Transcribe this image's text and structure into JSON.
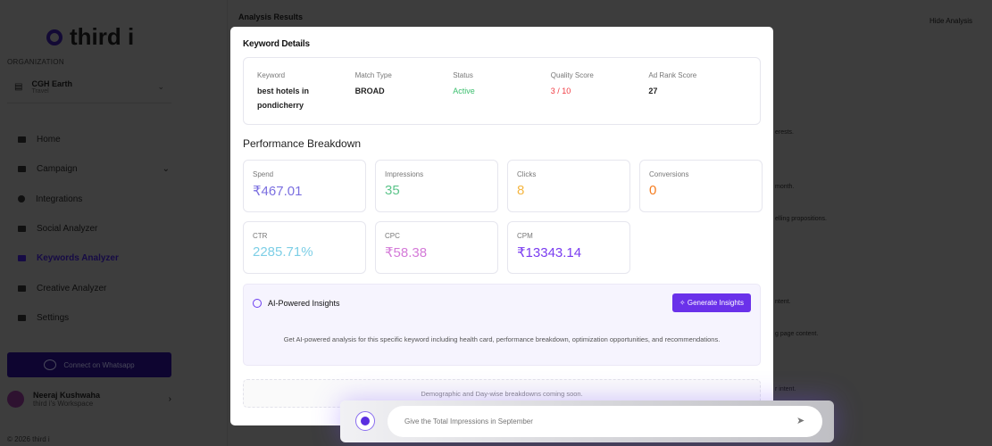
{
  "brand": "third i",
  "sidebar": {
    "org_label": "ORGANIZATION",
    "org_name": "CGH Earth",
    "org_type": "Travel",
    "items": [
      {
        "label": "Home"
      },
      {
        "label": "Campaign"
      },
      {
        "label": "Integrations"
      },
      {
        "label": "Social Analyzer"
      },
      {
        "label": "Keywords Analyzer"
      },
      {
        "label": "Creative Analyzer"
      },
      {
        "label": "Settings"
      }
    ],
    "whatsapp": "Connect on Whatsapp",
    "user_name": "Neeraj Kushwaha",
    "user_ws": "third i's Workspace",
    "copyright": "© 2026 third i"
  },
  "main": {
    "title": "Analysis Results",
    "hide": "Hide Analysis",
    "bg_lines": [
      "erests.",
      "month.",
      "elling propositions.",
      "ntent.",
      "g page content.",
      "r intent."
    ]
  },
  "modal": {
    "title": "Keyword Details",
    "details": [
      {
        "label": "Keyword",
        "value": "best hotels in pondicherry"
      },
      {
        "label": "Match Type",
        "value": "BROAD"
      },
      {
        "label": "Status",
        "value": "Active"
      },
      {
        "label": "Quality Score",
        "value": "3 / 10"
      },
      {
        "label": "Ad Rank Score",
        "value": "27"
      }
    ],
    "perf_title": "Performance Breakdown",
    "metrics": [
      {
        "label": "Spend",
        "value": "₹467.01",
        "color": "#7b6fe0"
      },
      {
        "label": "Impressions",
        "value": "35",
        "color": "#5cc48a"
      },
      {
        "label": "Clicks",
        "value": "8",
        "color": "#f5b642"
      },
      {
        "label": "Conversions",
        "value": "0",
        "color": "#f57c1f"
      },
      {
        "label": "CTR",
        "value": "2285.71%",
        "color": "#7ecfe6"
      },
      {
        "label": "CPC",
        "value": "₹58.38",
        "color": "#d47ad8"
      },
      {
        "label": "CPM",
        "value": "₹13343.14",
        "color": "#7a3cf0"
      }
    ],
    "ai_title": "AI-Powered Insights",
    "ai_button": "Generate Insights",
    "ai_desc": "Get AI-powered analysis for this specific keyword including health card, performance breakdown, optimization opportunities, and recommendations.",
    "soon": "Demographic and Day-wise breakdowns coming soon."
  },
  "chat": {
    "placeholder": "Give the Total Impressions in September"
  }
}
